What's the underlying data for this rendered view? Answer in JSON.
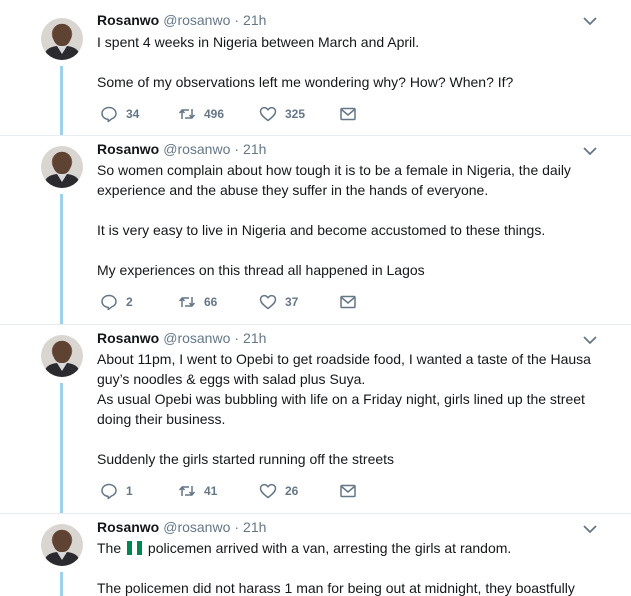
{
  "tweets": [
    {
      "name": "Rosanwo",
      "handle": "@rosanwo",
      "separator": "·",
      "time": "21h",
      "lines": [
        "I spent 4 weeks in Nigeria between March and April.",
        "",
        "Some of my observations left me wondering why? How? When? If?"
      ],
      "replies": "34",
      "retweets": "496",
      "likes": "325"
    },
    {
      "name": "Rosanwo",
      "handle": "@rosanwo",
      "separator": "·",
      "time": "21h",
      "lines": [
        "So women complain about how tough it is to be a female in Nigeria, the daily",
        "experience and the abuse they suffer in the hands of everyone.",
        "",
        "It is very easy to live in Nigeria and become accustomed to these things.",
        "",
        "My experiences on this thread all happened in Lagos"
      ],
      "replies": "2",
      "retweets": "66",
      "likes": "37"
    },
    {
      "name": "Rosanwo",
      "handle": "@rosanwo",
      "separator": "·",
      "time": "21h",
      "lines": [
        "About 11pm, I went to Opebi to get roadside food, I wanted a taste of the Hausa",
        "guy’s noodles & eggs with salad plus Suya.",
        "As usual Opebi was bubbling with life on a Friday night, girls lined up the street",
        "doing their business.",
        "",
        "Suddenly the girls started running off the streets"
      ],
      "replies": "1",
      "retweets": "41",
      "likes": "26"
    },
    {
      "name": "Rosanwo",
      "handle": "@rosanwo",
      "separator": "·",
      "time": "21h",
      "line1_before_flag": "The",
      "flag_icon": "nigeria-flag-emoji",
      "line1_after_flag": "policemen arrived with a van, arresting the girls at random.",
      "lines_rest": [
        "",
        "The policemen did not harass 1 man for being out at midnight, they boastfully"
      ]
    }
  ],
  "icons": {
    "reply": "reply-icon",
    "retweet": "retweet-icon",
    "like": "heart-icon",
    "dm": "envelope-icon",
    "caret": "chevron-down-icon"
  },
  "colors": {
    "thread_line": "#9fd0ea",
    "secondary_text": "#657786",
    "divider": "#e6ecf0",
    "flag_green": "#008751"
  }
}
